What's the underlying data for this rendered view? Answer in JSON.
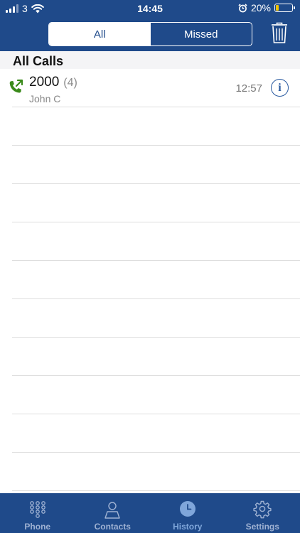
{
  "status_bar": {
    "carrier": "3",
    "time": "14:45",
    "battery_percent": "20%",
    "battery_level": 0.2
  },
  "segmented": {
    "all_label": "All",
    "missed_label": "Missed",
    "selected": "All"
  },
  "section": {
    "title": "All Calls"
  },
  "calls": [
    {
      "number": "2000",
      "count": "(4)",
      "name": "John C",
      "time": "12:57",
      "direction": "outgoing"
    }
  ],
  "tabs": [
    {
      "label": "Phone",
      "icon": "keypad-icon"
    },
    {
      "label": "Contacts",
      "icon": "person-icon"
    },
    {
      "label": "History",
      "icon": "clock-icon",
      "active": true
    },
    {
      "label": "Settings",
      "icon": "gear-icon"
    }
  ],
  "colors": {
    "brand": "#1f4a8a",
    "call_green": "#3a8a1a",
    "battery_low": "#f5c400"
  }
}
